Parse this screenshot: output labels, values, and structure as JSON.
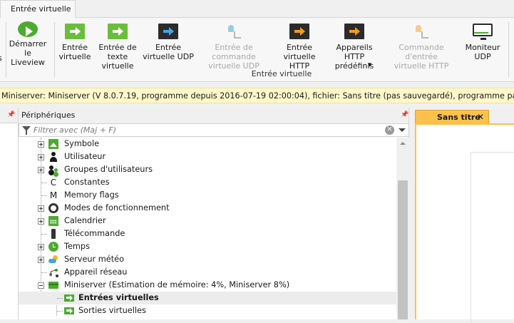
{
  "ribbon": {
    "tab_label": "Entrée virtuelle",
    "group_label": "Entrée virtuelle",
    "buttons": [
      {
        "label": "s",
        "icon": "cut-off-icon",
        "disabled": false
      },
      {
        "label": "Démarrer\nle Liveview",
        "icon": "play-icon",
        "disabled": false
      },
      {
        "label": "Entrée\nvirtuelle",
        "icon": "virtual-input-icon",
        "disabled": false
      },
      {
        "label": "Entrée de\ntexte virtuelle",
        "icon": "virtual-text-input-icon",
        "disabled": false
      },
      {
        "label": "Entrée\nvirtuelle UDP",
        "icon": "udp-input-icon",
        "disabled": false
      },
      {
        "label": "Entrée de commande\nvirtuelle UDP",
        "icon": "udp-command-icon",
        "disabled": true
      },
      {
        "label": "Entrée\nvirtuelle HTTP",
        "icon": "http-input-icon",
        "disabled": false
      },
      {
        "label": "Appareils HTTP\nprédéfinis",
        "icon": "http-devices-icon",
        "disabled": false
      },
      {
        "label": "Commande d'entrée\nvirtuelle HTTP",
        "icon": "http-command-icon",
        "disabled": true
      },
      {
        "label": "Moniteur\nUDP",
        "icon": "udp-monitor-icon",
        "disabled": false
      }
    ]
  },
  "infobar": {
    "text": "Miniserver: Miniserver (V 8.0.7.19, programme depuis 2016-07-19 02:00:04), fichier: Sans titre (pas sauvegardé), programme pas identique"
  },
  "periph": {
    "title": "Périphériques",
    "filter_placeholder": "Filtrer avec (Maj + F)",
    "items": [
      {
        "label": "Symbole",
        "icon": "symbol-icon",
        "expandable": true
      },
      {
        "label": "Utilisateur",
        "icon": "user-icon",
        "expandable": true
      },
      {
        "label": "Groupes d'utilisateurs",
        "icon": "user-group-icon",
        "expandable": true
      },
      {
        "label": "Constantes",
        "icon": "constant-icon",
        "expandable": false
      },
      {
        "label": "Memory flags",
        "icon": "memory-flag-icon",
        "expandable": false
      },
      {
        "label": "Modes de fonctionnement",
        "icon": "gear-icon",
        "expandable": true
      },
      {
        "label": "Calendrier",
        "icon": "calendar-icon",
        "expandable": true
      },
      {
        "label": "Télécommande",
        "icon": "remote-icon",
        "expandable": false
      },
      {
        "label": "Temps",
        "icon": "clock-icon",
        "expandable": true
      },
      {
        "label": "Serveur météo",
        "icon": "weather-icon",
        "expandable": true
      },
      {
        "label": "Appareil réseau",
        "icon": "network-icon",
        "expandable": false
      },
      {
        "label": "Miniserver (Estimation de mémoire: 4%, Miniserver 8%)",
        "icon": "miniserver-icon",
        "expandable": true,
        "expanded": true
      }
    ],
    "children": [
      {
        "label": "Entrées virtuelles",
        "icon": "virtual-inputs-icon",
        "selected": true
      },
      {
        "label": "Sorties virtuelles",
        "icon": "virtual-outputs-icon",
        "selected": false
      }
    ]
  },
  "document": {
    "tab_title": "Sans titre",
    "close_glyph": "✕"
  },
  "constants_glyph": "C",
  "memory_glyph": "M"
}
